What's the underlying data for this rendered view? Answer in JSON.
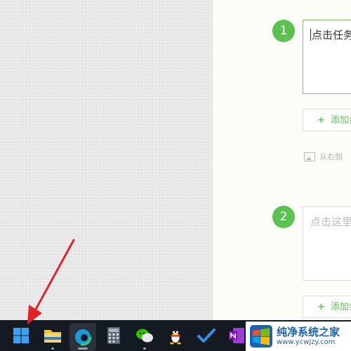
{
  "editor": {
    "steps": [
      {
        "number": "1",
        "text": "点击任务",
        "add_label": "添加步",
        "hint": "从右侧"
      },
      {
        "number": "2",
        "placeholder": "点击这里",
        "add_label": "添加步"
      }
    ],
    "add_symbol": "+"
  },
  "taskbar": {
    "apps": [
      "start",
      "file-explorer",
      "edge",
      "calculator",
      "wechat",
      "qq",
      "todo",
      "onenote"
    ]
  },
  "watermark": {
    "title": "纯净系统之家",
    "url": "www.ycwjzy.com"
  },
  "colors": {
    "accent_green": "#5ac24f",
    "taskbar": "#131a22",
    "arrow": "#e0242a",
    "watermark_blue": "#1a62b8"
  }
}
